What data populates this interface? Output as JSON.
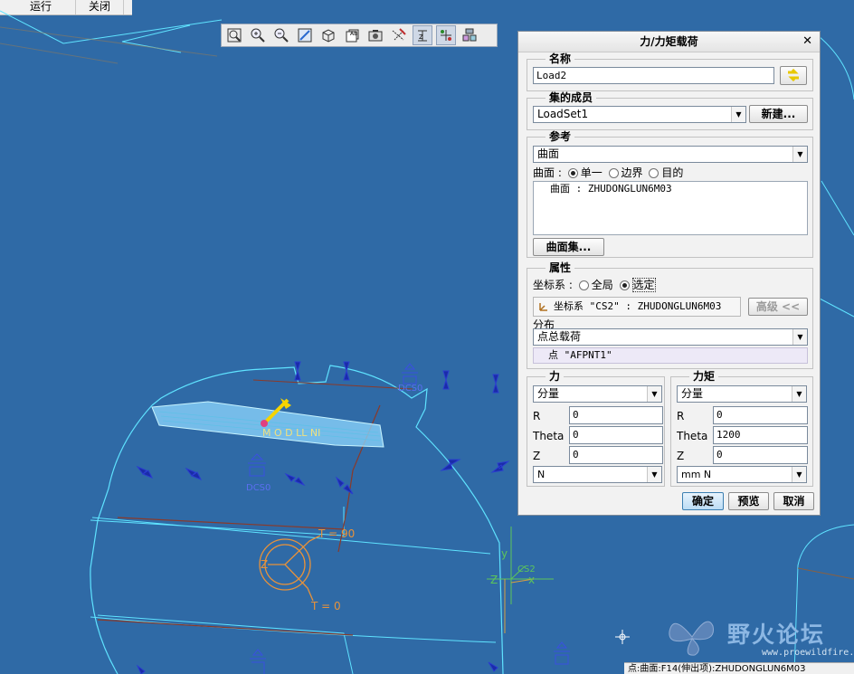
{
  "menu": {
    "run": "运行",
    "close": "关闭"
  },
  "toolbar": {
    "icons": [
      "zoom-fit-icon",
      "zoom-in-icon",
      "zoom-out-icon",
      "refit-icon",
      "view-orient-icon",
      "saved-views-icon",
      "display-style-icon",
      "datum-plane-display-icon",
      "axis-display-icon",
      "point-display-icon",
      "csys-display-icon"
    ]
  },
  "viewport": {
    "label_t90": "T = 90",
    "label_t0": "T = 0",
    "label_z": "Z",
    "label_y": "y",
    "label_x": "x",
    "label_z2": "Z",
    "label_csys": "CS2",
    "label_dcs": "DCS0",
    "label_dcs2": "DCS0",
    "label_load": "M O  D  LL   NI"
  },
  "dialog": {
    "title": "力/力矩载荷",
    "name_section": {
      "title": "名称",
      "value": "Load2"
    },
    "set_section": {
      "title": "集的成员",
      "value": "LoadSet1",
      "new_button": "新建..."
    },
    "ref_section": {
      "title": "参考",
      "type": "曲面",
      "surface_label": "曲面 :",
      "radio_single": "单一",
      "radio_boundary": "边界",
      "radio_target": "目的",
      "list_item": "曲面 : ZHUDONGLUN6M03",
      "surface_set_button": "曲面集..."
    },
    "prop_section": {
      "title": "属性",
      "csys_label": "坐标系 :",
      "radio_global": "全局",
      "radio_selected": "选定",
      "csys_value": "坐标系 \"CS2\" : ZHUDONGLUN6M03",
      "advanced_button": "高级 <<",
      "dist_label": "分布",
      "dist_value": "点总载荷",
      "point_value": "点 \"AFPNT1\""
    },
    "force_section": {
      "title": "力",
      "mode": "分量",
      "r_label": "R",
      "r_value": "0",
      "theta_label": "Theta",
      "theta_value": "0",
      "z_label": "Z",
      "z_value": "0",
      "unit": "N"
    },
    "moment_section": {
      "title": "力矩",
      "mode": "分量",
      "r_label": "R",
      "r_value": "0",
      "theta_label": "Theta",
      "theta_value": "1200",
      "z_label": "Z",
      "z_value": "0",
      "unit": "mm N"
    },
    "ok_button": "确定",
    "preview_button": "预览",
    "cancel_button": "取消"
  },
  "status": {
    "text": "点:曲面:F14(伸出项):ZHUDONGLUN6M03"
  },
  "watermark": {
    "title": "野火论坛",
    "url": "www.proewildfire.cn"
  }
}
